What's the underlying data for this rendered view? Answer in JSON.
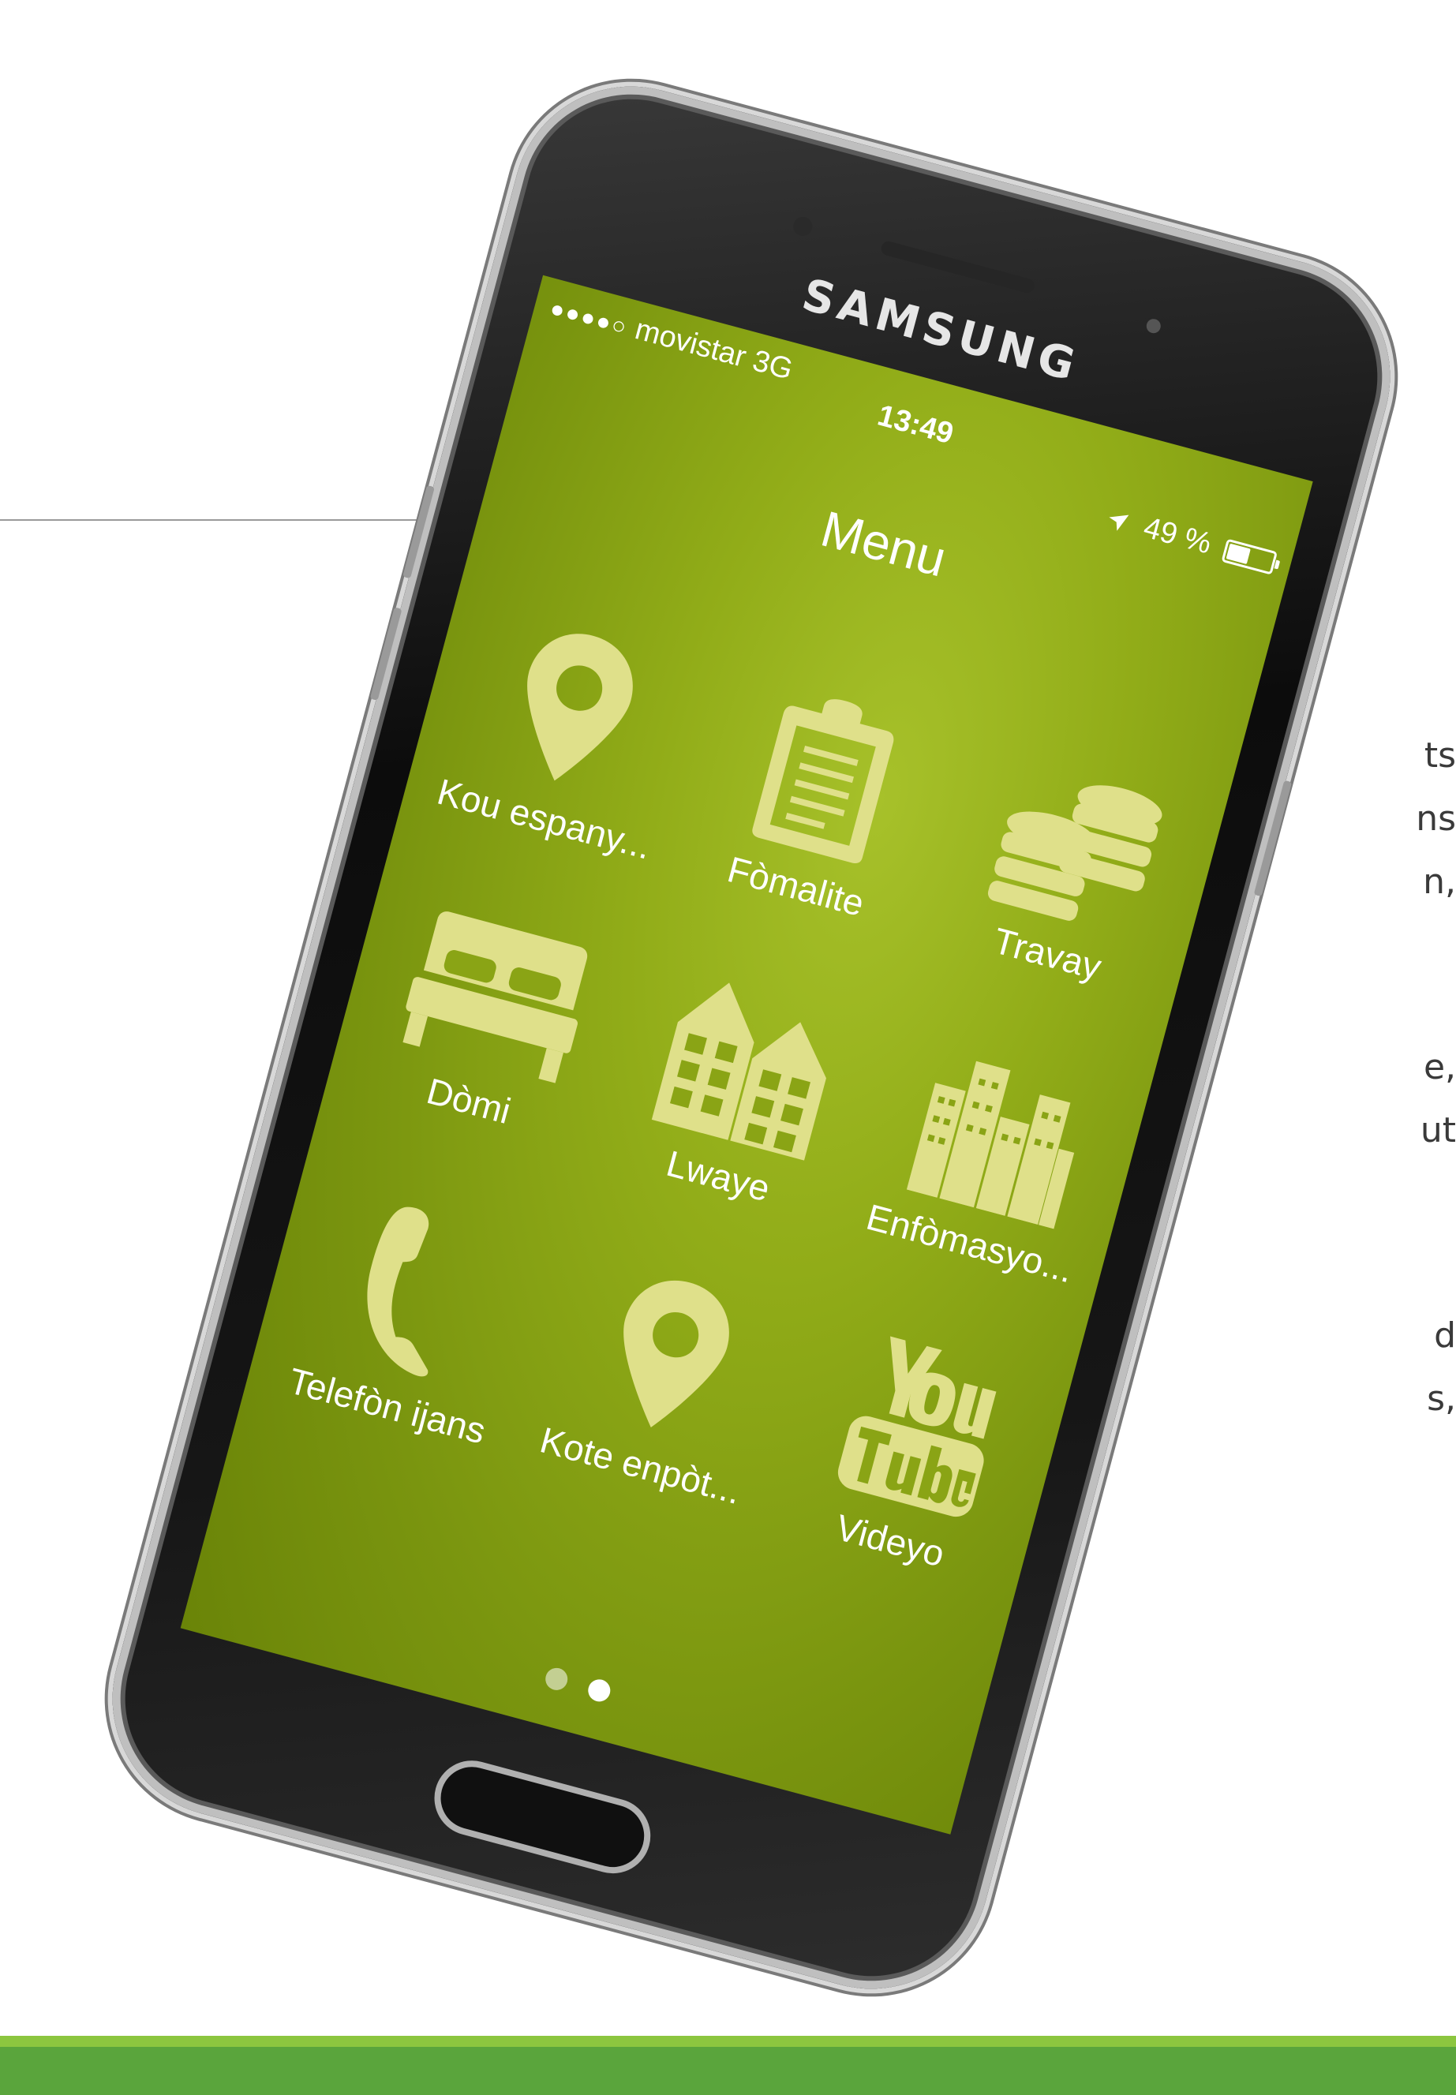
{
  "background_text": [
    "ts",
    "ns",
    "n,",
    "e,",
    "ut",
    "d",
    "s,"
  ],
  "phone": {
    "brand": "SAMSUNG",
    "status_bar": {
      "signal": "●●●●○",
      "carrier": "movistar",
      "network": "3G",
      "time": "13:49",
      "battery": "49 %",
      "battery_level_percent": 49
    },
    "menu_title": "Menu",
    "menu_items": [
      {
        "label": "Kou espany...",
        "icon": "map-pin-icon"
      },
      {
        "label": "Fòmalite",
        "icon": "clipboard-icon"
      },
      {
        "label": "Travay",
        "icon": "coins-icon"
      },
      {
        "label": "Dòmi",
        "icon": "bed-icon"
      },
      {
        "label": "Lwaye",
        "icon": "houses-icon"
      },
      {
        "label": "Enfòmasyo...",
        "icon": "city-buildings-icon"
      },
      {
        "label": "Telefòn ijans",
        "icon": "phone-icon"
      },
      {
        "label": "Kote enpòt...",
        "icon": "map-pin-icon"
      },
      {
        "label": "Videyo",
        "icon": "youtube-icon"
      }
    ],
    "pager": {
      "pages": 2,
      "active_page": 2
    }
  },
  "colors": {
    "screen_green": "#91ac18",
    "icon_fill": "#dfe08a",
    "band_light": "#8cc63f",
    "band_dark": "#5aa53c"
  }
}
